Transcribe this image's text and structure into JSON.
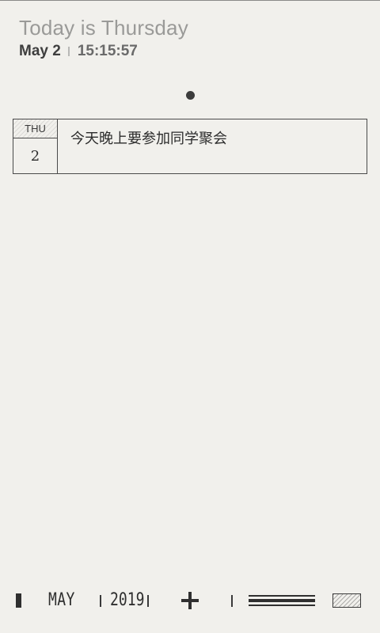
{
  "header": {
    "title": "Today is Thursday",
    "date": "May 2",
    "time": "15:15:57"
  },
  "pager": {
    "pages": 1,
    "current": 1
  },
  "events": [
    {
      "weekday": "THU",
      "day": "2",
      "text": "今天晚上要参加同学聚会"
    }
  ],
  "toolbar": {
    "month": "MAY",
    "year": "2019",
    "add_icon": "plus-icon",
    "list_view_icon": "lines-icon",
    "grid_view_icon": "hatched-box-icon"
  },
  "colors": {
    "background": "#f1f0ec",
    "ink": "#3a3a3a",
    "title_gray": "#9a9a98"
  }
}
